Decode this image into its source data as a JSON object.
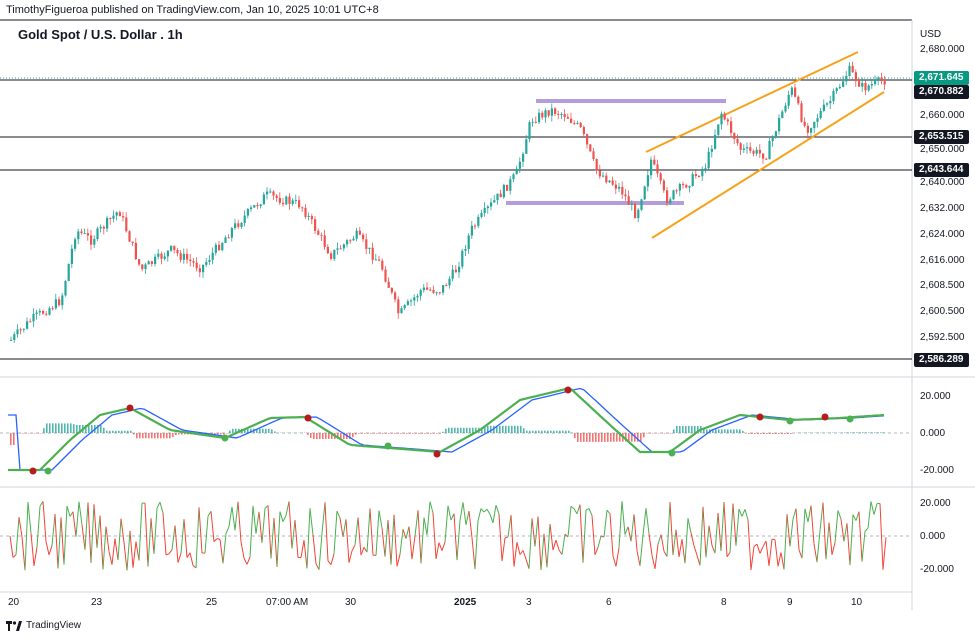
{
  "header": {
    "published": "TimothyFigueroa published on TradingView.com, Jan 10, 2025 10:01 UTC+8",
    "symbol_title": "Gold Spot / U.S. Dollar . 1h",
    "currency": "USD"
  },
  "colors": {
    "up": "#26a69a",
    "down": "#ef5350",
    "channel": "#f7a21b",
    "zone": "#b39ddb",
    "macd_fast": "#4caf50",
    "macd_slow": "#2962ff",
    "macd_fast_down": "#b71c1c",
    "osc_up": "#4caf50",
    "osc_down": "#f44336",
    "label_current": "#089981",
    "label_level": "#131722"
  },
  "price_axis": [
    "2,680.000",
    "2,660.000",
    "2,650.000",
    "2,640.000",
    "2,632.000",
    "2,624.000",
    "2,616.000",
    "2,608.500",
    "2,600.500",
    "2,592.500"
  ],
  "price_labels": {
    "current": "2,671.645",
    "level_1": "2,670.882",
    "level_2": "2,653.515",
    "level_3": "2,643.644",
    "level_4": "2,586.289"
  },
  "macd_axis": [
    "20.000",
    "0.000",
    "-20.000"
  ],
  "osc_axis": [
    "20.000",
    "0.000",
    "-20.000"
  ],
  "time_axis": [
    "20",
    "23",
    "25",
    "07:00 AM",
    "30",
    "2025",
    "3",
    "6",
    "8",
    "9",
    "10"
  ],
  "footer": {
    "brand": "TradingView"
  }
}
